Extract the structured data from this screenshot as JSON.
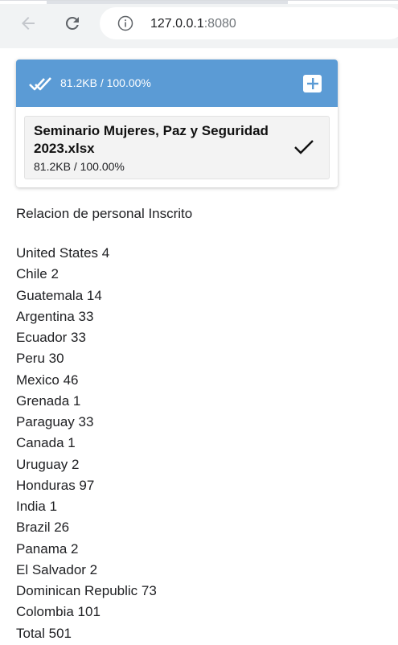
{
  "browser": {
    "url_host": "127.0.0.1",
    "url_port": ":8080"
  },
  "upload": {
    "header_status": "81.2KB / 100.00%",
    "file_name": "Seminario Mujeres, Paz y Seguridad 2023.xlsx",
    "file_status": "81.2KB / 100.00%",
    "icons": {
      "header": "done-all-icon",
      "add": "plus-icon",
      "file": "check-icon"
    },
    "colors": {
      "header_bg": "#5b9bd5"
    }
  },
  "report": {
    "title": "Relacion de personal Inscrito",
    "rows": [
      "United States 4",
      "Chile 2",
      "Guatemala 14",
      "Argentina 33",
      "Ecuador 33",
      "Peru 30",
      "Mexico 46",
      "Grenada 1",
      "Paraguay 33",
      "Canada 1",
      "Uruguay 2",
      "Honduras 97",
      "India 1",
      "Brazil 26",
      "Panama 2",
      "El Salvador 2",
      "Dominican Republic 73",
      "Colombia 101",
      "Total 501"
    ]
  }
}
